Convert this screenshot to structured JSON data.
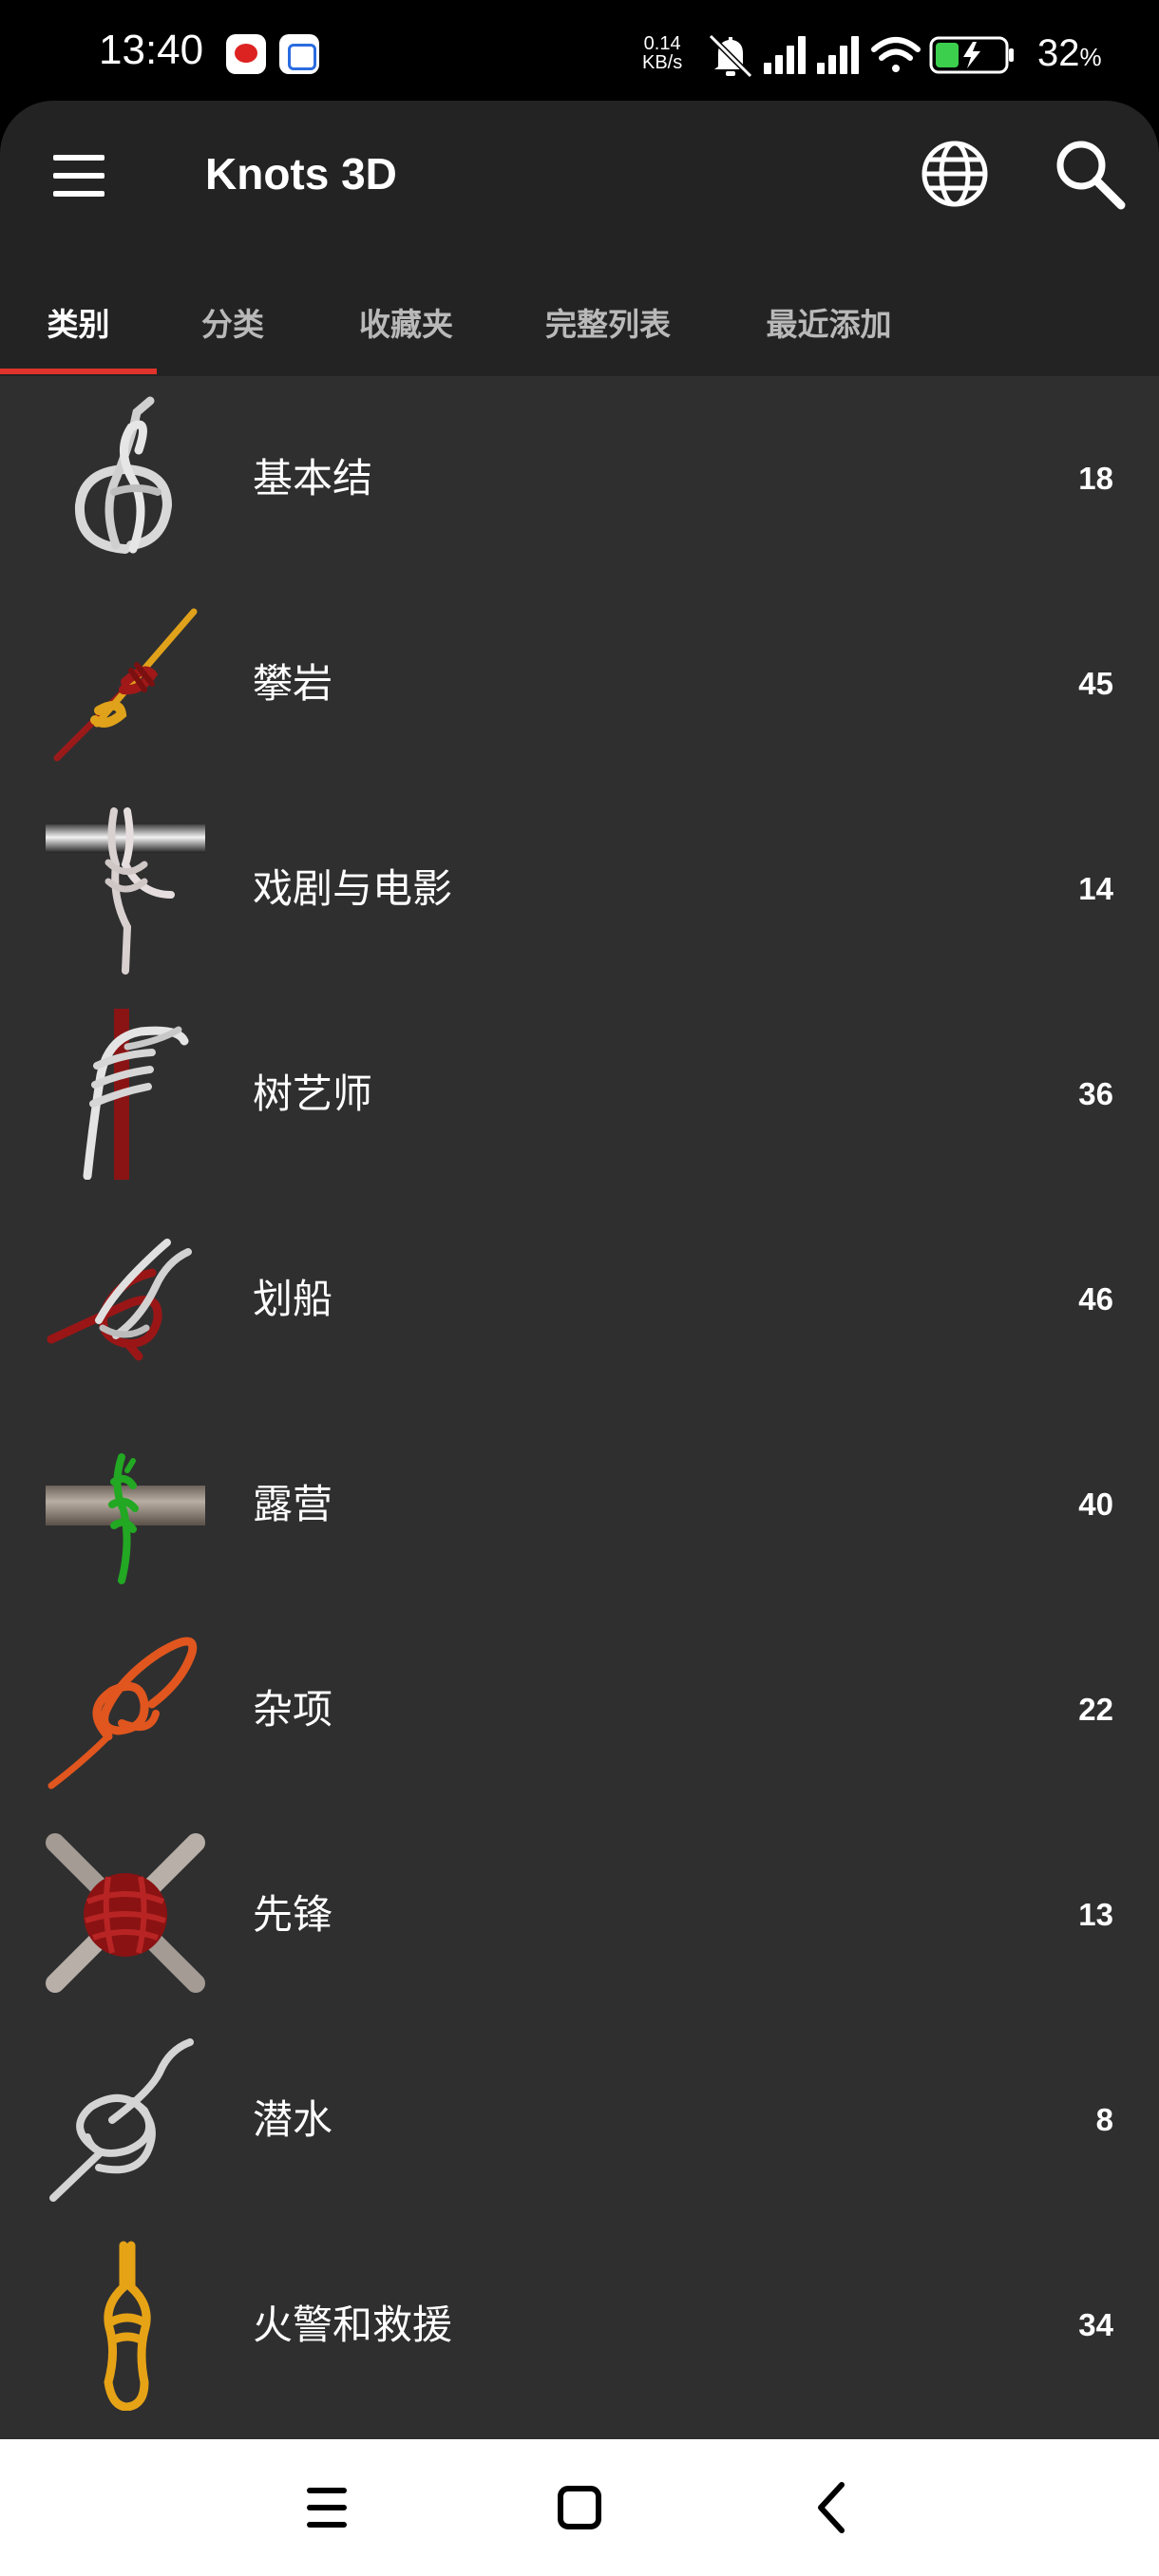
{
  "status_bar": {
    "time": "13:40",
    "net_speed_value": "0.14",
    "net_speed_unit": "KB/s",
    "battery_percent": "32",
    "battery_symbol": "%",
    "icons": [
      "notification-app-icon",
      "cloud-app-icon",
      "bell-muted-icon",
      "signal-icon",
      "signal-icon",
      "wifi-icon",
      "battery-charging-icon"
    ]
  },
  "app_bar": {
    "title": "Knots 3D",
    "icons": [
      "menu-icon",
      "globe-icon",
      "search-icon"
    ]
  },
  "tabs": [
    {
      "label": "类别",
      "active": true
    },
    {
      "label": "分类",
      "active": false
    },
    {
      "label": "收藏夹",
      "active": false
    },
    {
      "label": "完整列表",
      "active": false
    },
    {
      "label": "最近添加",
      "active": false
    }
  ],
  "categories": [
    {
      "label": "基本结",
      "count": "18"
    },
    {
      "label": "攀岩",
      "count": "45"
    },
    {
      "label": "戏剧与电影",
      "count": "14"
    },
    {
      "label": "树艺师",
      "count": "36"
    },
    {
      "label": "划船",
      "count": "46"
    },
    {
      "label": "露营",
      "count": "40"
    },
    {
      "label": "杂项",
      "count": "22"
    },
    {
      "label": "先锋",
      "count": "13"
    },
    {
      "label": "潜水",
      "count": "8"
    },
    {
      "label": "火警和救援",
      "count": "34"
    }
  ],
  "nav_bar": {
    "icons": [
      "recent-apps-icon",
      "home-icon",
      "back-icon"
    ]
  },
  "colors": {
    "accent": "#e0332b",
    "app_bar_bg": "#232323",
    "list_bg": "#2f2f30"
  }
}
